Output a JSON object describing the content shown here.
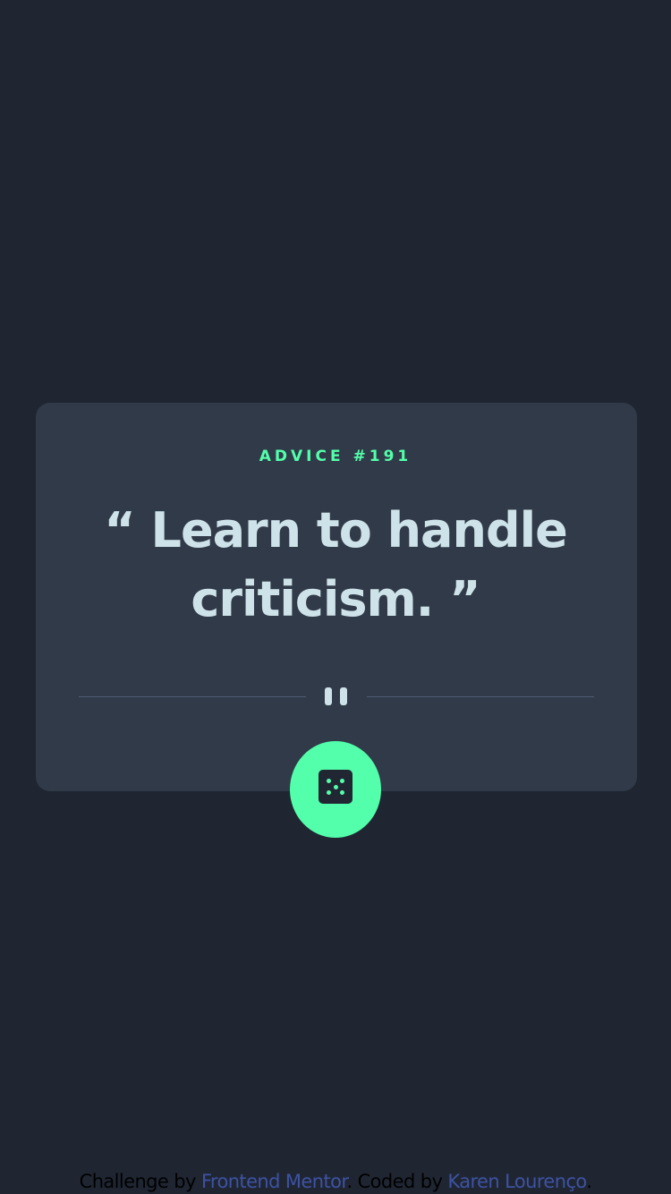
{
  "card": {
    "advice_label": "ADVICE #191",
    "quote": "“ Learn to handle criticism. ”"
  },
  "divider": {
    "icon": "pause-icon"
  },
  "dice_button": {
    "icon": "dice-icon"
  },
  "footer": {
    "challenge_prefix": "Challenge by ",
    "challenge_link": "Frontend Mentor",
    "coded_prefix": ". Coded by ",
    "coded_link": "Karen Lourenço",
    "suffix": "."
  },
  "colors": {
    "background": "#1f2632",
    "card": "#313a48",
    "accent_green": "#53ffaa",
    "quote_text": "#cee3e9",
    "link": "#3e52a3"
  }
}
